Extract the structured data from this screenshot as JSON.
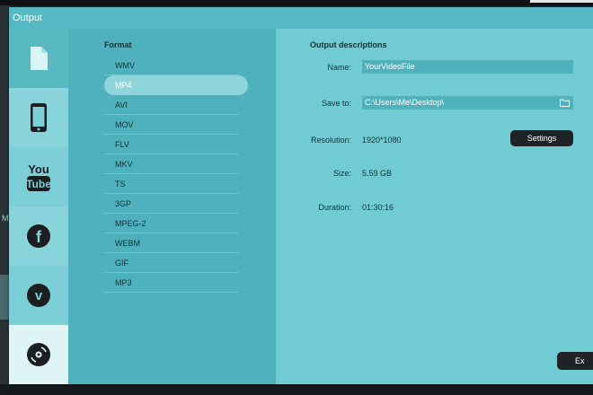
{
  "window": {
    "title": "Output"
  },
  "sidebar": {
    "items": [
      {
        "name": "file",
        "icon": "file-icon"
      },
      {
        "name": "device",
        "icon": "phone-icon"
      },
      {
        "name": "youtube",
        "icon": "youtube-icon",
        "label_top": "You",
        "label_bottom": "Tube"
      },
      {
        "name": "facebook",
        "icon": "facebook-icon",
        "label": "f"
      },
      {
        "name": "vimeo",
        "icon": "vimeo-icon",
        "label": "v"
      },
      {
        "name": "dvd",
        "icon": "disc-icon"
      }
    ]
  },
  "format": {
    "title": "Format",
    "selected": "MP4",
    "items": [
      "WMV",
      "MP4",
      "AVI",
      "MOV",
      "FLV",
      "MKV",
      "TS",
      "3GP",
      "MPEG-2",
      "WEBM",
      "GIF",
      "MP3"
    ]
  },
  "output": {
    "title": "Output descriptions",
    "name_label": "Name:",
    "name_value": "YourVideoFile",
    "save_label": "Save to:",
    "save_value": "C:\\Users\\Me\\Desktop\\",
    "resolution_label": "Resolution:",
    "resolution_value": "1920*1080",
    "settings_button": "Settings",
    "size_label": "Size:",
    "size_value": "5.59 GB",
    "duration_label": "Duration:",
    "duration_value": "01:30:16"
  },
  "footer": {
    "export_button": "Ex"
  },
  "background": {
    "left_glyph": "M"
  },
  "colors": {
    "accent": "#56b8c2",
    "panel": "#4fb1bc",
    "button": "#1f2326"
  }
}
